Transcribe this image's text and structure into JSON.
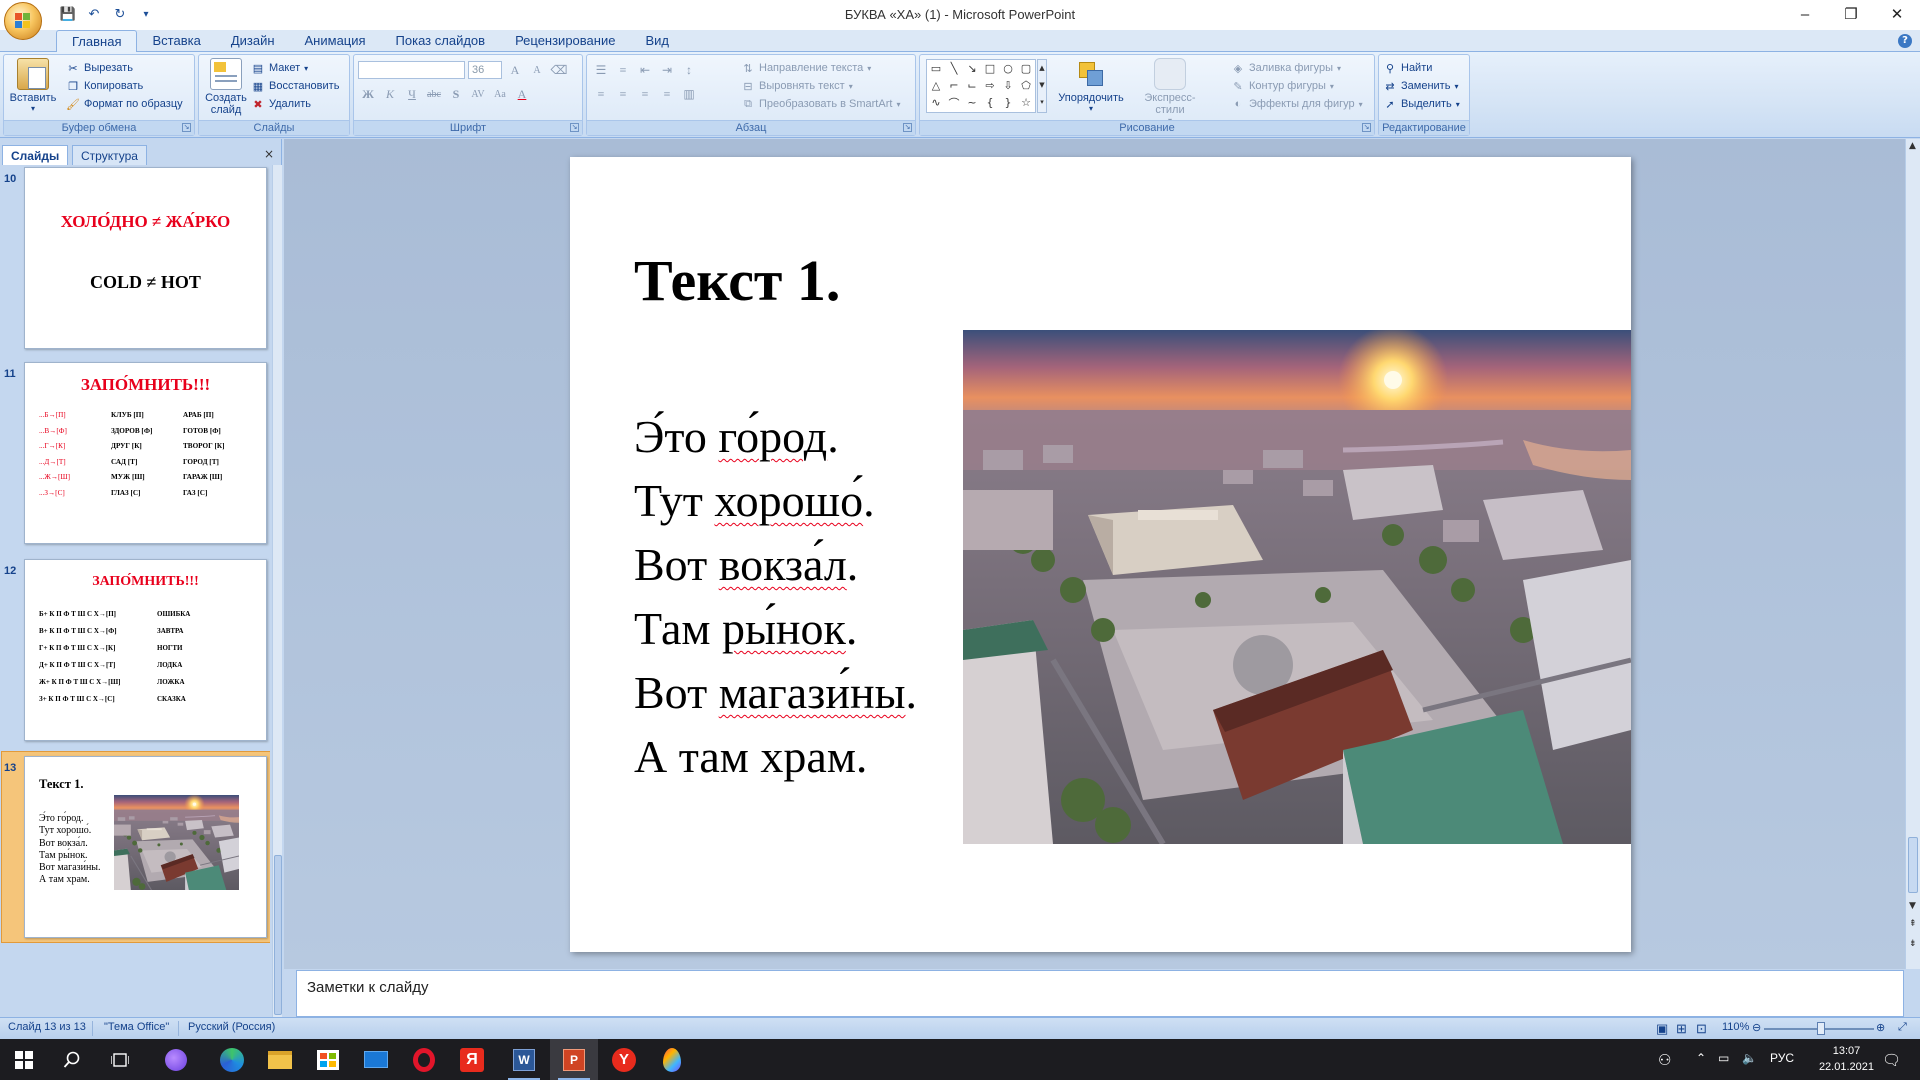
{
  "window": {
    "title": "БУКВА «ХА» (1) - Microsoft PowerPoint",
    "minimize": "–",
    "maximize": "❐",
    "close": "✕"
  },
  "quick_access": {
    "save": "💾",
    "undo": "↶",
    "redo": "↻",
    "more": "▾"
  },
  "ribbon": {
    "tabs": [
      "Главная",
      "Вставка",
      "Дизайн",
      "Анимация",
      "Показ слайдов",
      "Рецензирование",
      "Вид"
    ],
    "active_tab": "Главная",
    "help": "?",
    "clipboard": {
      "label": "Буфер обмена",
      "paste": "Вставить",
      "cut": "Вырезать",
      "copy": "Копировать",
      "format_painter": "Формат по образцу"
    },
    "slides": {
      "label": "Слайды",
      "new_slide": "Создать слайд",
      "layout": "Макет",
      "reset": "Восстановить",
      "delete": "Удалить"
    },
    "font": {
      "label": "Шрифт",
      "family_value": "",
      "size_value": "36",
      "bold": "Ж",
      "italic": "К",
      "underline": "Ч",
      "strike": "abc",
      "shadow": "S",
      "spacing": "AV",
      "case": "Aa",
      "color": "A",
      "grow": "A",
      "shrink": "A"
    },
    "paragraph": {
      "label": "Абзац",
      "text_direction": "Направление текста",
      "align_text": "Выровнять текст",
      "smartart": "Преобразовать в SmartArt"
    },
    "drawing": {
      "label": "Рисование",
      "arrange": "Упорядочить",
      "quick_styles": "Экспресс-стили",
      "shape_fill": "Заливка фигуры",
      "shape_outline": "Контур фигуры",
      "shape_effects": "Эффекты для фигур"
    },
    "editing": {
      "label": "Редактирование",
      "find": "Найти",
      "replace": "Заменить",
      "select": "Выделить"
    }
  },
  "slide_pane": {
    "tab_slides": "Слайды",
    "tab_outline": "Структура",
    "close": "×",
    "thumbs": [
      {
        "number": "10",
        "line1": "ХОЛО́ДНО ≠ ЖА́РКО",
        "line2": "COLD ≠ HOT"
      },
      {
        "number": "11",
        "title": "ЗАПО́МНИТЬ!!!",
        "col1": [
          "...Б→[П]",
          "...В→[Ф]",
          "...Г→[К]",
          "...Д→[Т]",
          "...Ж→[Ш]",
          "...З→[С]"
        ],
        "col2": [
          "КЛУБ [П]",
          "ЗДОРОВ [Ф]",
          "ДРУГ [К]",
          "САД [Т]",
          "МУЖ [Ш]",
          "ГЛАЗ [С]"
        ],
        "col3": [
          "АРАБ [П]",
          "ГОТОВ [Ф]",
          "ТВОРОГ [К]",
          "ГОРОД [Т]",
          "ГАРАЖ [Ш]",
          "ГАЗ [С]"
        ]
      },
      {
        "number": "12",
        "title": "ЗАПО́МНИТЬ!!!",
        "col1": [
          "Б+ К П Ф Т Ш С Х→[П]",
          "В+ К П Ф Т Ш С Х→[Ф]",
          "Г+ К П Ф Т Ш С Х→[К]",
          "Д+ К П Ф Т Ш С Х→[Т]",
          "Ж+ К П Ф Т Ш С Х→[Ш]",
          "З+ К П Ф Т Ш С Х→[С]"
        ],
        "col2": [
          "ОШИБКА",
          "ЗАВТРА",
          "НОГТИ",
          "ЛОДКА",
          "ЛОЖКА",
          "СКАЗКА"
        ]
      },
      {
        "number": "13",
        "title": "Текст 1.",
        "lines": [
          "Э́то го́род.",
          "Тут хорошо́.",
          "Вот вокза́л.",
          "Там ры́нок.",
          "Вот магази́ны.",
          "А там храм."
        ]
      }
    ]
  },
  "slide": {
    "title": "Текст 1.",
    "lines": [
      "Э́то",
      "го́род",
      ".",
      "Тут",
      "хорошо́",
      ".",
      "Вот",
      "вокза́л",
      ".",
      "Там",
      "ры́нок",
      ".",
      "Вот",
      "магази́ны",
      ".",
      "А там храм."
    ]
  },
  "notes": {
    "placeholder": "Заметки к слайду"
  },
  "status": {
    "slide_info": "Слайд 13 из 13",
    "theme": "\"Тема Office\"",
    "language": "Русский (Россия)",
    "zoom": "110%",
    "zoom_level_percent": 110
  },
  "taskbar": {
    "lang": "РУС",
    "time": "13:07",
    "date": "22.01.2021"
  },
  "colors": {
    "accent_red": "#e8001c",
    "ribbon_text": "#15428b",
    "taskbar": "#1c1c20"
  }
}
